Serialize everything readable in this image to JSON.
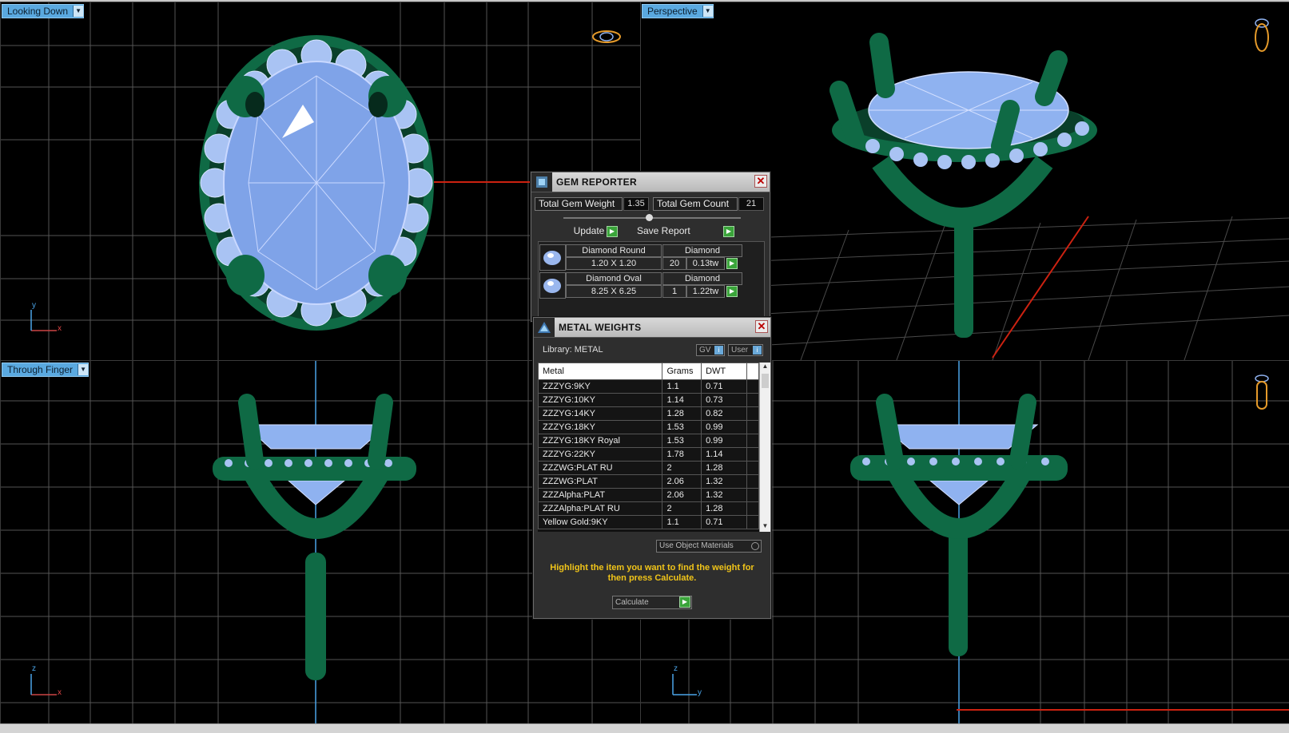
{
  "viewports": {
    "top_left": {
      "label": "Looking Down",
      "axis_v": "y",
      "axis_h": "x"
    },
    "top_right": {
      "label": "Perspective"
    },
    "bottom_left": {
      "label": "Through Finger",
      "axis_v": "z",
      "axis_h": "x"
    },
    "bottom_right": {
      "axis_v": "z",
      "axis_h": "y"
    }
  },
  "gem_reporter": {
    "title": "GEM REPORTER",
    "total_weight_label": "Total Gem Weight",
    "total_weight_value": "1.35",
    "total_count_label": "Total Gem Count",
    "total_count_value": "21",
    "update_label": "Update",
    "save_report_label": "Save Report",
    "gems": [
      {
        "name": "Diamond Round",
        "size": "1.20 X 1.20",
        "material": "Diamond",
        "count": "20",
        "weight": "0.13tw"
      },
      {
        "name": "Diamond Oval",
        "size": "8.25 X 6.25",
        "material": "Diamond",
        "count": "1",
        "weight": "1.22tw"
      }
    ]
  },
  "metal_weights": {
    "title": "METAL WEIGHTS",
    "library_label": "Library: METAL",
    "gv_label": "GV",
    "user_label": "User",
    "columns": [
      "Metal",
      "Grams",
      "DWT"
    ],
    "rows": [
      {
        "metal": "ZZZYG:9KY",
        "grams": "1.1",
        "dwt": "0.71"
      },
      {
        "metal": "ZZZYG:10KY",
        "grams": "1.14",
        "dwt": "0.73"
      },
      {
        "metal": "ZZZYG:14KY",
        "grams": "1.28",
        "dwt": "0.82"
      },
      {
        "metal": "ZZZYG:18KY",
        "grams": "1.53",
        "dwt": "0.99"
      },
      {
        "metal": "ZZZYG:18KY Royal",
        "grams": "1.53",
        "dwt": "0.99"
      },
      {
        "metal": "ZZZYG:22KY",
        "grams": "1.78",
        "dwt": "1.14"
      },
      {
        "metal": "ZZZWG:PLAT RU",
        "grams": "2",
        "dwt": "1.28"
      },
      {
        "metal": "ZZZWG:PLAT",
        "grams": "2.06",
        "dwt": "1.32"
      },
      {
        "metal": "ZZZAlpha:PLAT",
        "grams": "2.06",
        "dwt": "1.32"
      },
      {
        "metal": "ZZZAlpha:PLAT RU",
        "grams": "2",
        "dwt": "1.28"
      },
      {
        "metal": "Yellow Gold:9KY",
        "grams": "1.1",
        "dwt": "0.71"
      }
    ],
    "use_object_materials_label": "Use Object Materials",
    "hint_text": "Highlight the item you want to find the weight for then press Calculate.",
    "calculate_label": "Calculate"
  },
  "colors": {
    "metal_green": "#0f6a45",
    "gem_blue": "#8fb2f0",
    "viewport_label_bg": "#5aa9e0",
    "hint_yellow": "#f0c419"
  }
}
